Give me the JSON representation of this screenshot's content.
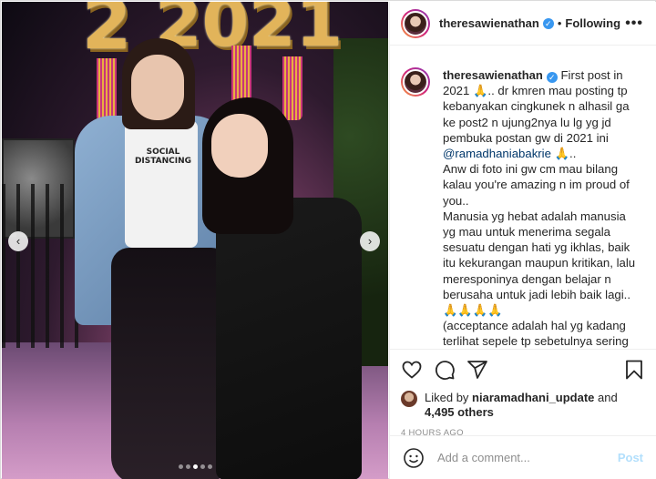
{
  "header": {
    "username": "theresawienathan",
    "verified_icon": "verified-badge-icon",
    "separator": "•",
    "follow_status": "Following",
    "more_label": "•••"
  },
  "photo": {
    "balloon_text_left": "2",
    "balloon_text_right": "2021",
    "shirt_text": "SOCIAL DISTANCING"
  },
  "caption": {
    "username": "theresawienathan",
    "line1": " First post in 2021 🙏.. dr kmren mau posting tp kebanyakan cingkunek n alhasil ga ke post2 n ujung2nya lu lg yg jd pembuka postan gw di 2021 ini",
    "mention": "@ramadhaniabakrie",
    "mention_suffix": " 🙏..",
    "p2": "Anw di foto ini gw cm mau bilang kalau you're amazing n im proud of you..",
    "p3": "Manusia yg hebat adalah manusia yg mau untuk menerima segala sesuatu dengan hati yg ikhlas, baik itu kekurangan maupun kritikan, lalu meresponinya dengan belajar n berusaha untuk jadi lebih baik lagi..",
    "p3_emoji": "🙏🙏🙏🙏",
    "p4": "(acceptance adalah hal yg kadang terlihat sepele tp sebetulnya sering kali sulit di lakukan bnyk org dan"
  },
  "actions": {
    "like_icon": "heart-icon",
    "comment_icon": "comment-icon",
    "share_icon": "share-icon",
    "save_icon": "bookmark-icon"
  },
  "likes": {
    "prefix": "Liked by ",
    "user": "niaramadhani_update",
    "and": " and",
    "others": "4,495 others"
  },
  "timestamp": "4 HOURS AGO",
  "comment_box": {
    "placeholder": "Add a comment...",
    "post_label": "Post",
    "emoji_icon": "smiley-icon"
  },
  "carousel": {
    "prev_icon": "chevron-left-icon",
    "next_icon": "chevron-right-icon",
    "slide_count": 5,
    "active_index": 2
  }
}
